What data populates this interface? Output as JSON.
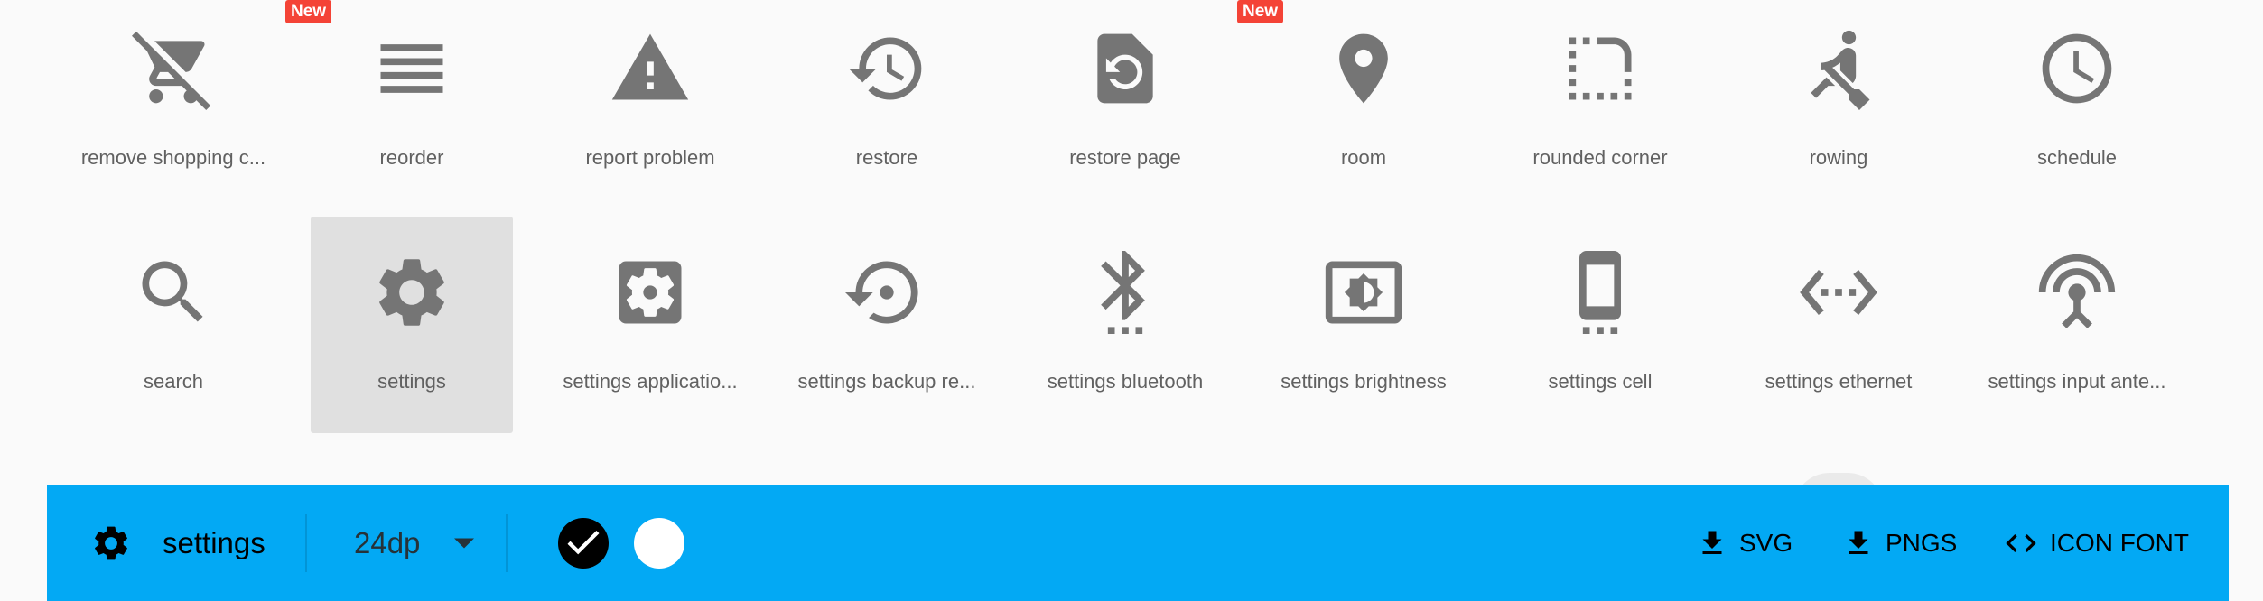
{
  "icons_row1": [
    {
      "name": "remove shopping c...",
      "badge": "New"
    },
    {
      "name": "reorder"
    },
    {
      "name": "report problem"
    },
    {
      "name": "restore"
    },
    {
      "name": "restore page",
      "badge": "New"
    },
    {
      "name": "room"
    },
    {
      "name": "rounded corner"
    },
    {
      "name": "rowing"
    },
    {
      "name": "schedule"
    }
  ],
  "icons_row2": [
    {
      "name": "search"
    },
    {
      "name": "settings",
      "selected": true
    },
    {
      "name": "settings applicatio..."
    },
    {
      "name": "settings backup re..."
    },
    {
      "name": "settings bluetooth"
    },
    {
      "name": "settings brightness"
    },
    {
      "name": "settings cell"
    },
    {
      "name": "settings ethernet"
    },
    {
      "name": "settings input ante..."
    }
  ],
  "toolbar": {
    "selected_icon": "gear-icon",
    "selected_name": "settings",
    "size": "24dp",
    "colors": [
      "#000000",
      "#ffffff"
    ],
    "download_svg": "SVG",
    "download_pngs": "PNGS",
    "icon_font": "ICON FONT"
  },
  "colors": {
    "accent": "#03a9f4",
    "badge": "#f44336",
    "icon": "#757575"
  }
}
